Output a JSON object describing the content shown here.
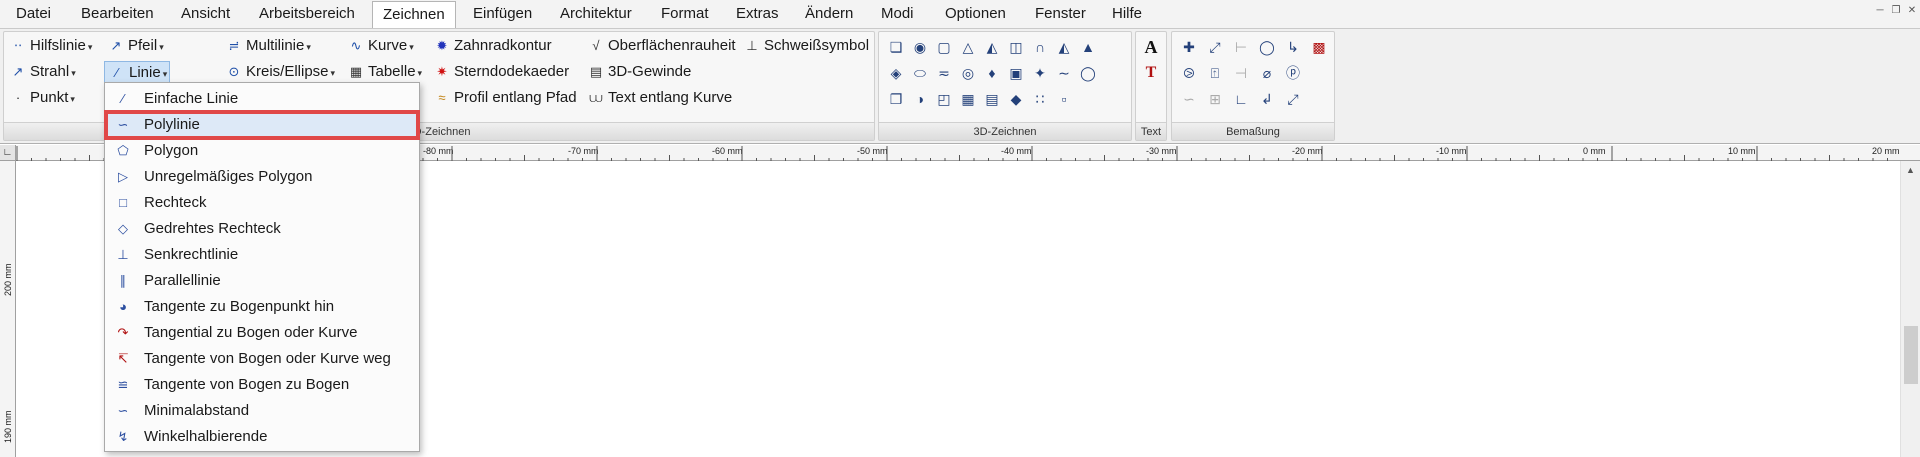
{
  "menubar": {
    "items": [
      "Datei",
      "Bearbeiten",
      "Ansicht",
      "Arbeitsbereich",
      "Zeichnen",
      "Einfügen",
      "Architektur",
      "Format",
      "Extras",
      "Ändern",
      "Modi",
      "Optionen",
      "Fenster",
      "Hilfe"
    ],
    "active": "Zeichnen"
  },
  "ribbon": {
    "group_2d_label": "2D-Zeichnen",
    "group_2d_label_visible": "-Zeichnen",
    "group_3d_label": "3D-Zeichnen",
    "group_text_label": "Text",
    "group_dim_label": "Bemaßung",
    "commands": {
      "hilfslinie": "Hilfslinie",
      "strahl": "Strahl",
      "punkt": "Punkt",
      "pfeil": "Pfeil",
      "linie": "Linie",
      "multilinie": "Multilinie",
      "kreis_ellipse": "Kreis/Ellipse",
      "kurve": "Kurve",
      "tabelle": "Tabelle",
      "zahnradkontur": "Zahnradkontur",
      "sterndodekaeder": "Sterndodekaeder",
      "profil_entlang_pfad": "Profil entlang Pfad",
      "oberflaechenrauheit": "Oberflächenrauheit",
      "gewinde_3d": "3D-Gewinde",
      "text_entlang_kurve": "Text entlang Kurve",
      "schweisssymbol": "Schweißsymbol"
    }
  },
  "ruler": {
    "h_labels": [
      "-80 mm",
      "-70 mm",
      "-60 mm",
      "-50 mm",
      "-40 mm",
      "-30 mm",
      "-20 mm",
      "-10 mm",
      "0 mm",
      "10 mm",
      "20 mm"
    ],
    "v_labels": [
      "200 mm",
      "190 mm"
    ]
  },
  "linie_menu": {
    "items": [
      {
        "label": "Einfache Linie",
        "icon": "simple-line-icon"
      },
      {
        "label": "Polylinie",
        "icon": "polyline-icon",
        "highlighted": true
      },
      {
        "label": "Polygon",
        "icon": "polygon-icon"
      },
      {
        "label": "Unregelmäßiges Polygon",
        "icon": "irregular-polygon-icon"
      },
      {
        "label": "Rechteck",
        "icon": "rectangle-icon"
      },
      {
        "label": "Gedrehtes Rechteck",
        "icon": "rotated-rectangle-icon"
      },
      {
        "label": "Senkrechtlinie",
        "icon": "perpendicular-line-icon"
      },
      {
        "label": "Parallellinie",
        "icon": "parallel-line-icon"
      },
      {
        "label": "Tangente zu Bogenpunkt hin",
        "icon": "tangent-to-arc-point-icon"
      },
      {
        "label": "Tangential zu Bogen oder Kurve",
        "icon": "tangential-to-arc-icon"
      },
      {
        "label": "Tangente von Bogen oder Kurve weg",
        "icon": "tangent-from-arc-icon"
      },
      {
        "label": "Tangente von Bogen zu Bogen",
        "icon": "tangent-arc-to-arc-icon"
      },
      {
        "label": "Minimalabstand",
        "icon": "minimal-distance-icon"
      },
      {
        "label": "Winkelhalbierende",
        "icon": "angle-bisector-icon"
      }
    ]
  },
  "colors": {
    "highlight_border": "#e04848",
    "icon_blue": "#1e4fa8"
  }
}
